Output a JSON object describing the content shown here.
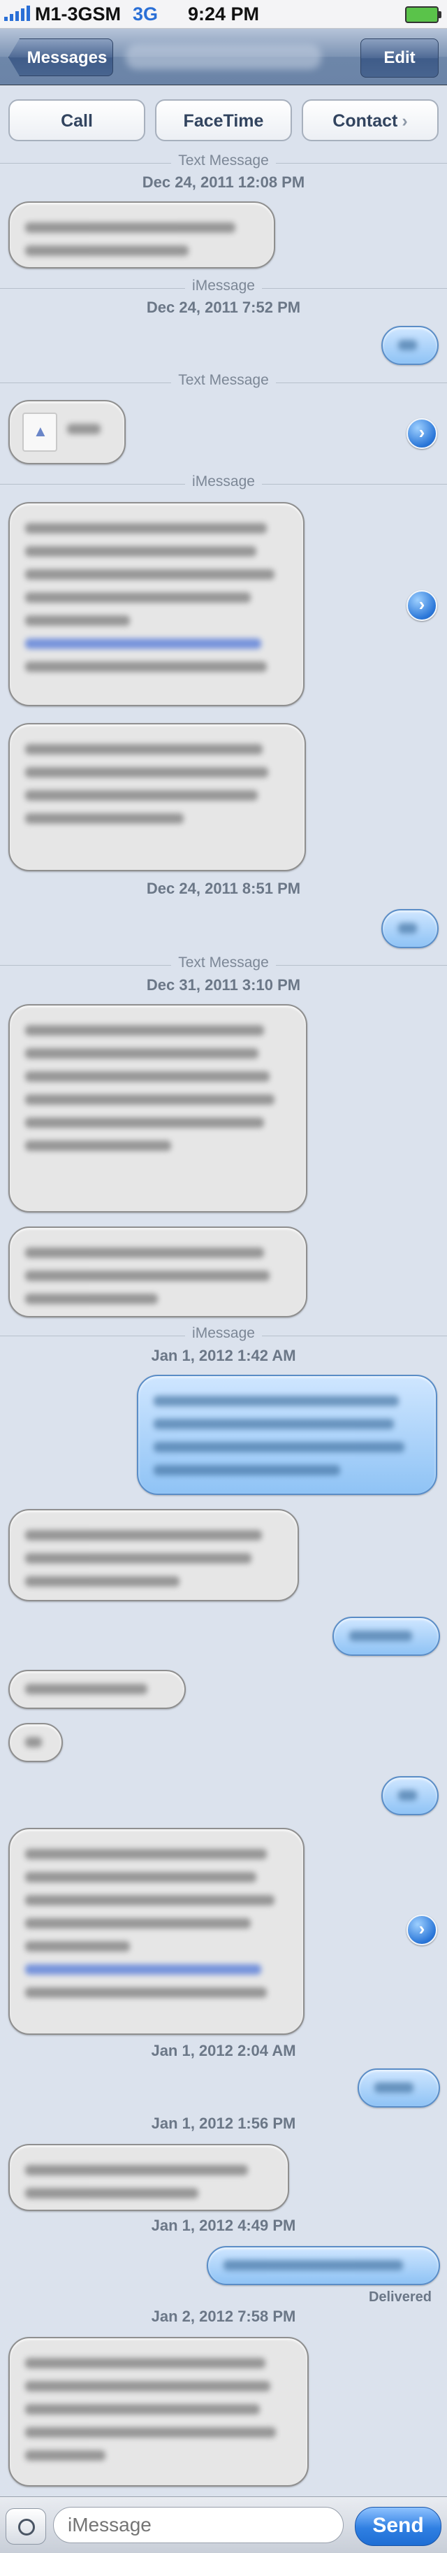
{
  "status": {
    "carrier": "M1-3GSM",
    "network": "3G",
    "time": "9:24 PM"
  },
  "nav": {
    "back_label": "Messages",
    "edit_label": "Edit"
  },
  "actions": {
    "call": "Call",
    "facetime": "FaceTime",
    "contact": "Contact"
  },
  "labels": {
    "text_message": "Text Message",
    "imessage": "iMessage",
    "delivered": "Delivered"
  },
  "timestamps": {
    "t1": "Dec 24, 2011 12:08 PM",
    "t2": "Dec 24, 2011 7:52 PM",
    "t3": "Dec 24, 2011 8:51 PM",
    "t4": "Dec 31, 2011 3:10 PM",
    "t5": "Jan 1, 2012 1:42 AM",
    "t6": "Jan 1, 2012 2:04 AM",
    "t7": "Jan 1, 2012 1:56 PM",
    "t8": "Jan 1, 2012 4:49 PM",
    "t9": "Jan 2, 2012 7:58 PM"
  },
  "composer": {
    "placeholder": "iMessage",
    "send_label": "Send"
  },
  "icons": {
    "camera": "camera-icon",
    "share": "share-arrow-icon",
    "contact": "contact-card-icon"
  }
}
